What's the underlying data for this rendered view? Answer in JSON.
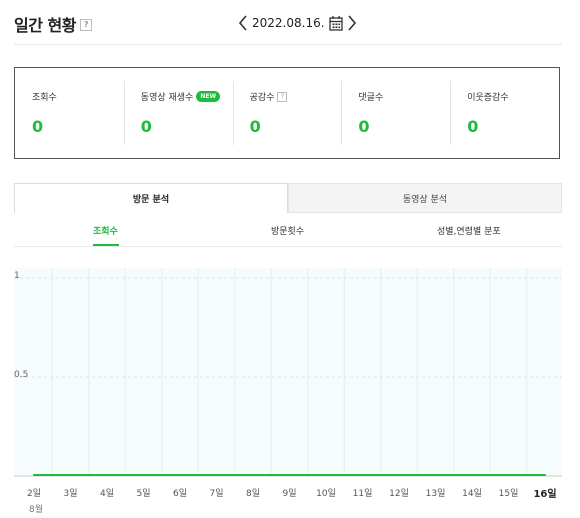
{
  "header": {
    "title": "일간 현황",
    "help_glyph": "?",
    "date": "2022.08.16."
  },
  "stats": [
    {
      "label": "조회수",
      "value": "0"
    },
    {
      "label": "동영상 재생수",
      "value": "0",
      "badge": "NEW"
    },
    {
      "label": "공감수",
      "value": "0",
      "help": "?"
    },
    {
      "label": "댓글수",
      "value": "0"
    },
    {
      "label": "이웃증감수",
      "value": "0"
    }
  ],
  "tabs": [
    {
      "label": "방문 분석",
      "active": true
    },
    {
      "label": "동영상 분석",
      "active": false
    }
  ],
  "subtabs": [
    {
      "label": "조회수",
      "active": true
    },
    {
      "label": "방문횟수",
      "active": false
    },
    {
      "label": "성별,연령별 분포",
      "active": false
    }
  ],
  "chart_data": {
    "type": "line",
    "x": [
      "2일",
      "3일",
      "4일",
      "5일",
      "6일",
      "7일",
      "8일",
      "9일",
      "10일",
      "11일",
      "12일",
      "13일",
      "14일",
      "15일",
      "16일"
    ],
    "x_sublabel": "8월",
    "yticks": [
      "1",
      "0.5"
    ],
    "ylim": [
      0,
      1
    ],
    "series": [
      {
        "values": [
          0,
          0,
          0,
          0,
          0,
          0,
          0,
          0,
          0,
          0,
          0,
          0,
          0,
          0,
          0
        ],
        "color": "#1ebc3d"
      }
    ],
    "grid": true,
    "background": "#f6fbfd"
  },
  "colors": {
    "accent": "#1ebc3d",
    "border": "#555555"
  }
}
